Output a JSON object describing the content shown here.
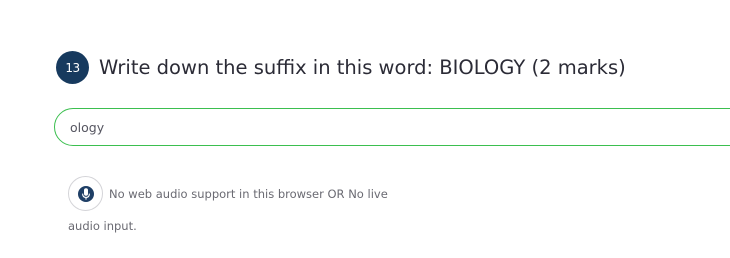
{
  "question": {
    "number": "13",
    "text": "Write down the suffix in this word: BIOLOGY (2 marks)"
  },
  "answer": {
    "value": "ology",
    "border_color": "#3bbf4f"
  },
  "audio": {
    "icon": "microphone-icon",
    "message_line1": "No web audio support in this browser OR No live",
    "message_line2": "audio input."
  },
  "colors": {
    "badge_background": "#173a5e",
    "mic_color": "#1f3f66"
  }
}
